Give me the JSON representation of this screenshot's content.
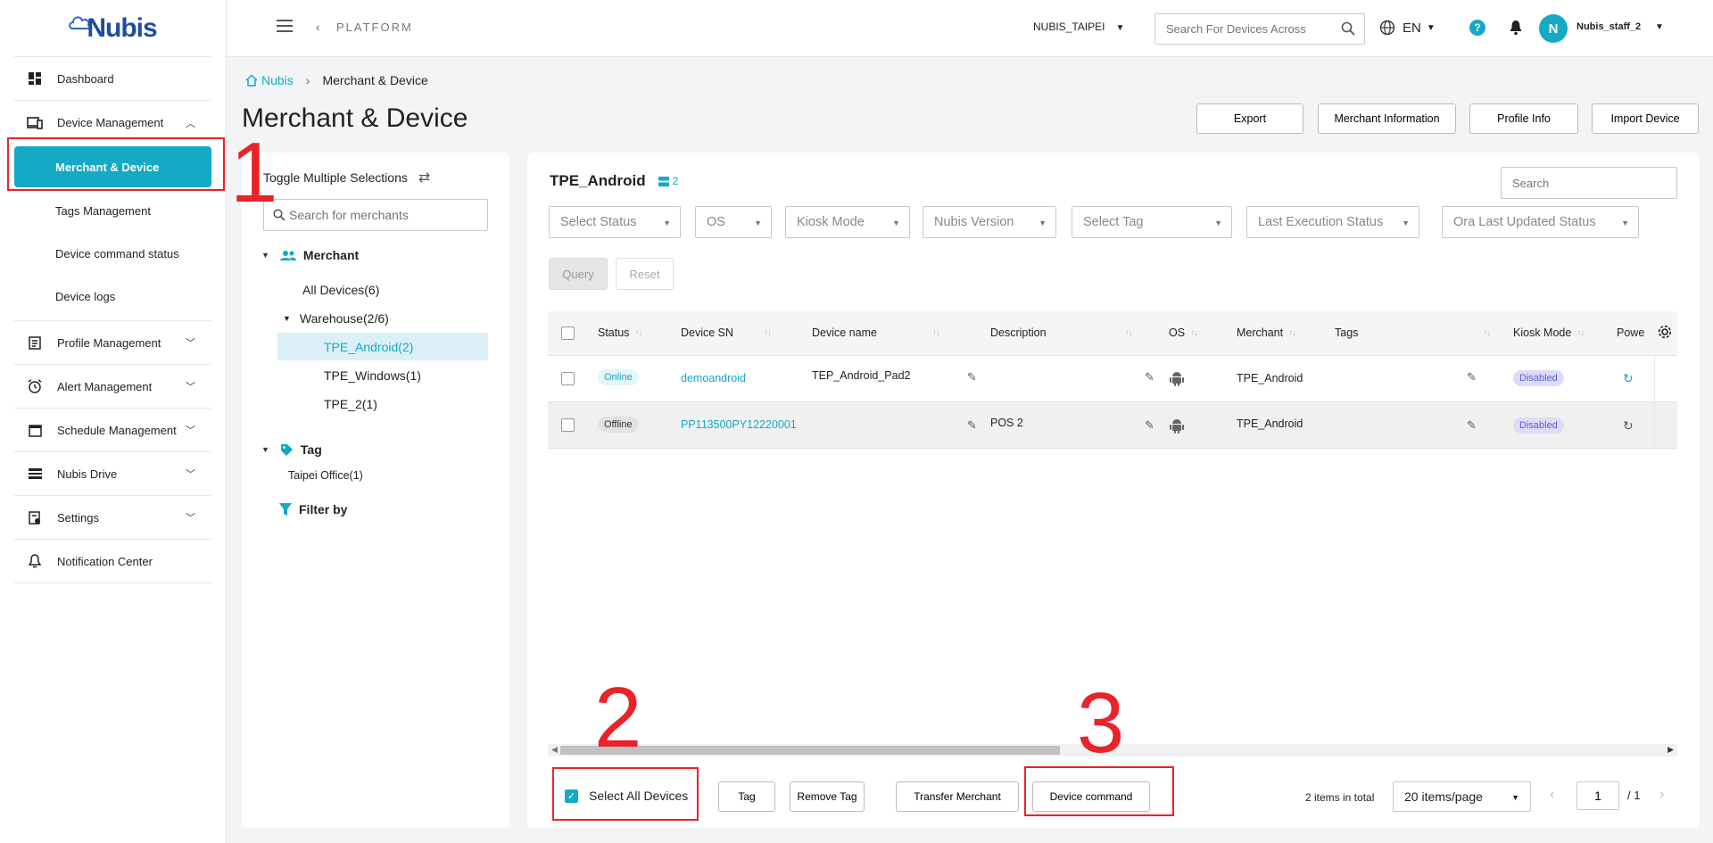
{
  "sidebar": {
    "logo": "Nubis",
    "items": [
      {
        "label": "Dashboard",
        "icon": "dashboard-icon"
      },
      {
        "label": "Device Management",
        "icon": "devices-icon",
        "expanded": true
      },
      {
        "label": "Profile Management",
        "icon": "profile-icon"
      },
      {
        "label": "Alert Management",
        "icon": "alarm-icon"
      },
      {
        "label": "Schedule Management",
        "icon": "calendar-icon"
      },
      {
        "label": "Nubis Drive",
        "icon": "drive-icon"
      },
      {
        "label": "Settings",
        "icon": "settings-icon"
      },
      {
        "label": "Notification Center",
        "icon": "bell-icon"
      }
    ],
    "sub_items": [
      {
        "label": "Merchant & Device",
        "active": true
      },
      {
        "label": "Tags Management"
      },
      {
        "label": "Device command status"
      },
      {
        "label": "Device logs"
      }
    ]
  },
  "topbar": {
    "platform": "PLATFORM",
    "org": "NUBIS_TAIPEI",
    "search_placeholder": "Search For Devices Across",
    "lang": "EN",
    "help": "?",
    "avatar_letter": "N",
    "user": "Nubis_staff_2"
  },
  "breadcrumb": {
    "home": "Nubis",
    "current": "Merchant & Device"
  },
  "page": {
    "title": "Merchant & Device",
    "buttons": {
      "export": "Export",
      "merchant_info": "Merchant Information",
      "profile_info": "Profile Info",
      "import": "Import Device"
    }
  },
  "tree": {
    "toggle": "Toggle Multiple Selections",
    "search_placeholder": "Search for merchants",
    "merchant_heading": "Merchant",
    "all_devices": "All Devices(6)",
    "warehouse": "Warehouse(2/6)",
    "children": [
      "TPE_Android(2)",
      "TPE_Windows(1)",
      "TPE_2(1)"
    ],
    "tag_heading": "Tag",
    "tag_item": "Taipei Office(1)",
    "filter_by": "Filter by"
  },
  "main": {
    "title": "TPE_Android",
    "count": "2",
    "search_placeholder": "Search",
    "filters": [
      "Select Status",
      "OS",
      "Kiosk Mode",
      "Nubis Version",
      "Select Tag",
      "Last Execution Status",
      "Ora Last Updated Status"
    ],
    "query": "Query",
    "reset": "Reset",
    "columns": [
      "Status",
      "Device SN",
      "Device name",
      "Description",
      "OS",
      "Merchant",
      "Tags",
      "Kiosk Mode",
      "Powe"
    ],
    "rows": [
      {
        "status": "Online",
        "sn": "demoandroid",
        "name": "TEP_Android_Pad2",
        "description": "",
        "merchant": "TPE_Android",
        "kiosk": "Disabled"
      },
      {
        "status": "Offline",
        "sn": "PP113500PY12220001",
        "name": "",
        "description": "POS 2",
        "merchant": "TPE_Android",
        "kiosk": "Disabled"
      }
    ],
    "bottom": {
      "select_all": "Select All Devices",
      "tag": "Tag",
      "remove_tag": "Remove Tag",
      "transfer": "Transfer Merchant",
      "device_command": "Device command",
      "total": "2 items in total",
      "per_page": "20 items/page",
      "page": "1",
      "page_of": "/ 1"
    }
  },
  "annotations": {
    "one": "1",
    "two": "2",
    "three": "3"
  },
  "colors": {
    "accent": "#14a9c4",
    "annotation": "#e8232a"
  }
}
